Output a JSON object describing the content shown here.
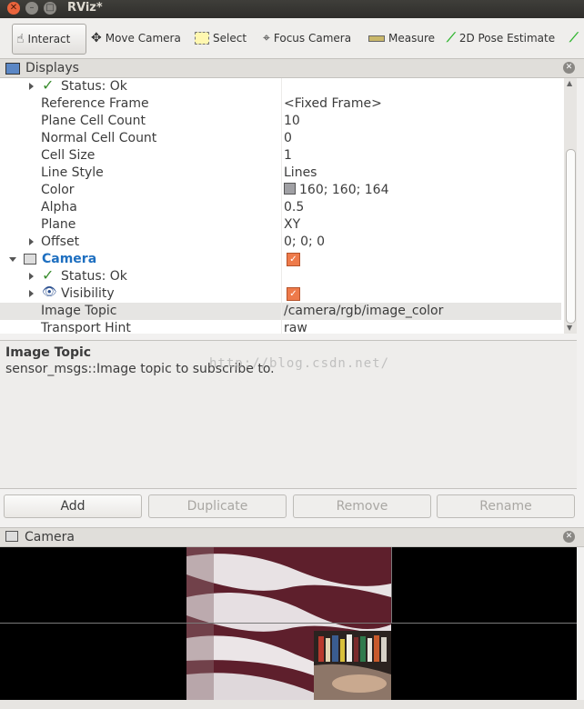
{
  "window": {
    "title": "RViz*"
  },
  "toolbar": {
    "tools": [
      {
        "label": "Interact",
        "icon": "hand-icon",
        "active": true
      },
      {
        "label": "Move Camera",
        "icon": "move-icon"
      },
      {
        "label": "Select",
        "icon": "select-icon"
      },
      {
        "label": "Focus Camera",
        "icon": "focus-icon"
      },
      {
        "label": "Measure",
        "icon": "ruler-icon"
      },
      {
        "label": "2D Pose Estimate",
        "icon": "green-arrow-icon"
      }
    ]
  },
  "displays_panel": {
    "title": "Displays",
    "rows": [
      {
        "key": "Status: Ok",
        "value": ""
      },
      {
        "key": "Reference Frame",
        "value": "<Fixed Frame>"
      },
      {
        "key": "Plane Cell Count",
        "value": "10"
      },
      {
        "key": "Normal Cell Count",
        "value": "0"
      },
      {
        "key": "Cell Size",
        "value": "1"
      },
      {
        "key": "Line Style",
        "value": "Lines"
      },
      {
        "key": "Color",
        "value": "160; 160; 164",
        "swatch": "#a0a0a4"
      },
      {
        "key": "Alpha",
        "value": "0.5"
      },
      {
        "key": "Plane",
        "value": "XY"
      },
      {
        "key": "Offset",
        "value": "0; 0; 0"
      },
      {
        "key": "Camera",
        "value": "",
        "checked": true,
        "accent": "#1e6fc0"
      },
      {
        "key": "Status: Ok",
        "value": ""
      },
      {
        "key": "Visibility",
        "value": "",
        "checked": true
      },
      {
        "key": "Image Topic",
        "value": "/camera/rgb/image_color"
      },
      {
        "key": "Transport Hint",
        "value": "raw"
      }
    ],
    "description_title": "Image Topic",
    "description_body": "sensor_msgs::Image topic to subscribe to.",
    "watermark": "http://blog.csdn.net/"
  },
  "buttons": {
    "add": "Add",
    "duplicate": "Duplicate",
    "remove": "Remove",
    "rename": "Rename"
  },
  "camera_panel": {
    "title": "Camera"
  }
}
